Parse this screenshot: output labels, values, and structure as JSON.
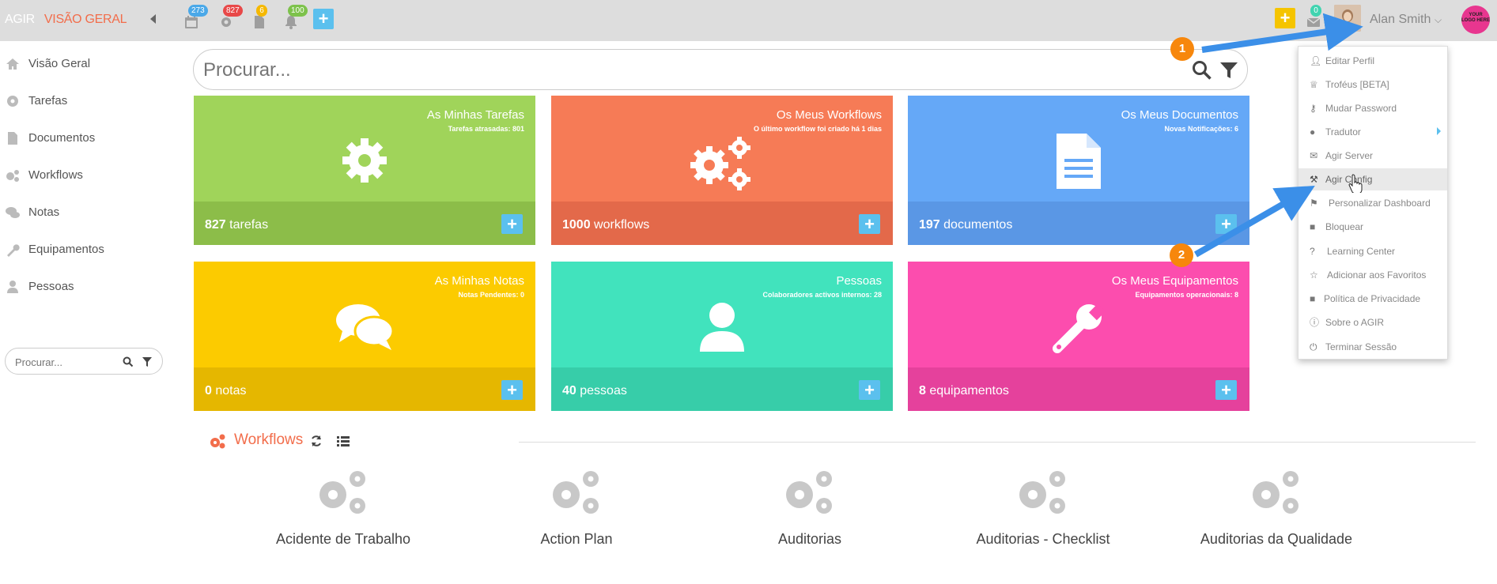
{
  "brand": {
    "name": "AGIR",
    "section": "VISÃO GERAL"
  },
  "topbar": {
    "calendar_badge": "273",
    "tasks_badge": "827",
    "documents_badge": "6",
    "notifications_badge": "100",
    "messages_badge": "0",
    "user_name": "Alan Smith",
    "logo_text": "YOUR LOGO HERE"
  },
  "sidebar": {
    "items": [
      {
        "label": "Visão Geral",
        "icon": "home-icon"
      },
      {
        "label": "Tarefas",
        "icon": "gear-icon"
      },
      {
        "label": "Documentos",
        "icon": "document-icon"
      },
      {
        "label": "Workflows",
        "icon": "gears-icon"
      },
      {
        "label": "Notas",
        "icon": "comments-icon"
      },
      {
        "label": "Equipamentos",
        "icon": "wrench-icon"
      },
      {
        "label": "Pessoas",
        "icon": "user-icon"
      }
    ],
    "search_placeholder": "Procurar..."
  },
  "search": {
    "placeholder": "Procurar..."
  },
  "tiles": [
    {
      "title": "As Minhas Tarefas",
      "subtitle": "Tarefas atrasadas: 801",
      "count": "827",
      "unit": "tarefas",
      "color": "#a0d45a",
      "foot": "#8cbd49"
    },
    {
      "title": "Os Meus Workflows",
      "subtitle": "O último workflow foi criado há 1 dias",
      "count": "1000",
      "unit": "workflows",
      "color": "#f67b56",
      "foot": "#e3694a"
    },
    {
      "title": "Os Meus Documentos",
      "subtitle": "Novas Notificações: 6",
      "count": "197",
      "unit": "documentos",
      "color": "#65a8f7",
      "foot": "#5a97e5"
    },
    {
      "title": "As Minhas Notas",
      "subtitle": "Notas Pendentes: 0",
      "count": "0",
      "unit": "notas",
      "color": "#fccb00",
      "foot": "#e5b700"
    },
    {
      "title": "Pessoas",
      "subtitle": "Colaboradores activos internos: 28",
      "count": "40",
      "unit": "pessoas",
      "color": "#41e3bd",
      "foot": "#37cda9"
    },
    {
      "title": "Os Meus Equipamentos",
      "subtitle": "Equipamentos operacionais: 8",
      "count": "8",
      "unit": "equipamentos",
      "color": "#fc4dae",
      "foot": "#e5419c"
    }
  ],
  "workflows": {
    "title": "Workflows",
    "items": [
      "Acidente de Trabalho",
      "Action Plan",
      "Auditorias",
      "Auditorias - Checklist",
      "Auditorias da Qualidade"
    ]
  },
  "user_menu": {
    "items": [
      {
        "label": "Editar Perfil",
        "icon": "user-icon"
      },
      {
        "label": "Troféus [BETA]",
        "icon": "trophy-icon"
      },
      {
        "label": "Mudar Password",
        "icon": "key-icon"
      },
      {
        "label": "Tradutor",
        "icon": "globe-icon"
      },
      {
        "label": "Agir Server",
        "icon": "envelope-icon"
      },
      {
        "label": "Agir Config",
        "icon": "wrench-icon"
      },
      {
        "label": "Personalizar Dashboard",
        "icon": "flag-icon"
      },
      {
        "label": "Bloquear",
        "icon": "lock-icon"
      },
      {
        "label": "Learning Center",
        "icon": "question-icon"
      },
      {
        "label": "Adicionar aos Favoritos",
        "icon": "star-icon"
      },
      {
        "label": "Política de Privacidade",
        "icon": "lock-icon"
      },
      {
        "label": "Sobre o AGIR",
        "icon": "info-icon"
      },
      {
        "label": "Terminar Sessão",
        "icon": "power-icon"
      }
    ]
  },
  "annotations": {
    "step1": "1",
    "step2": "2"
  }
}
